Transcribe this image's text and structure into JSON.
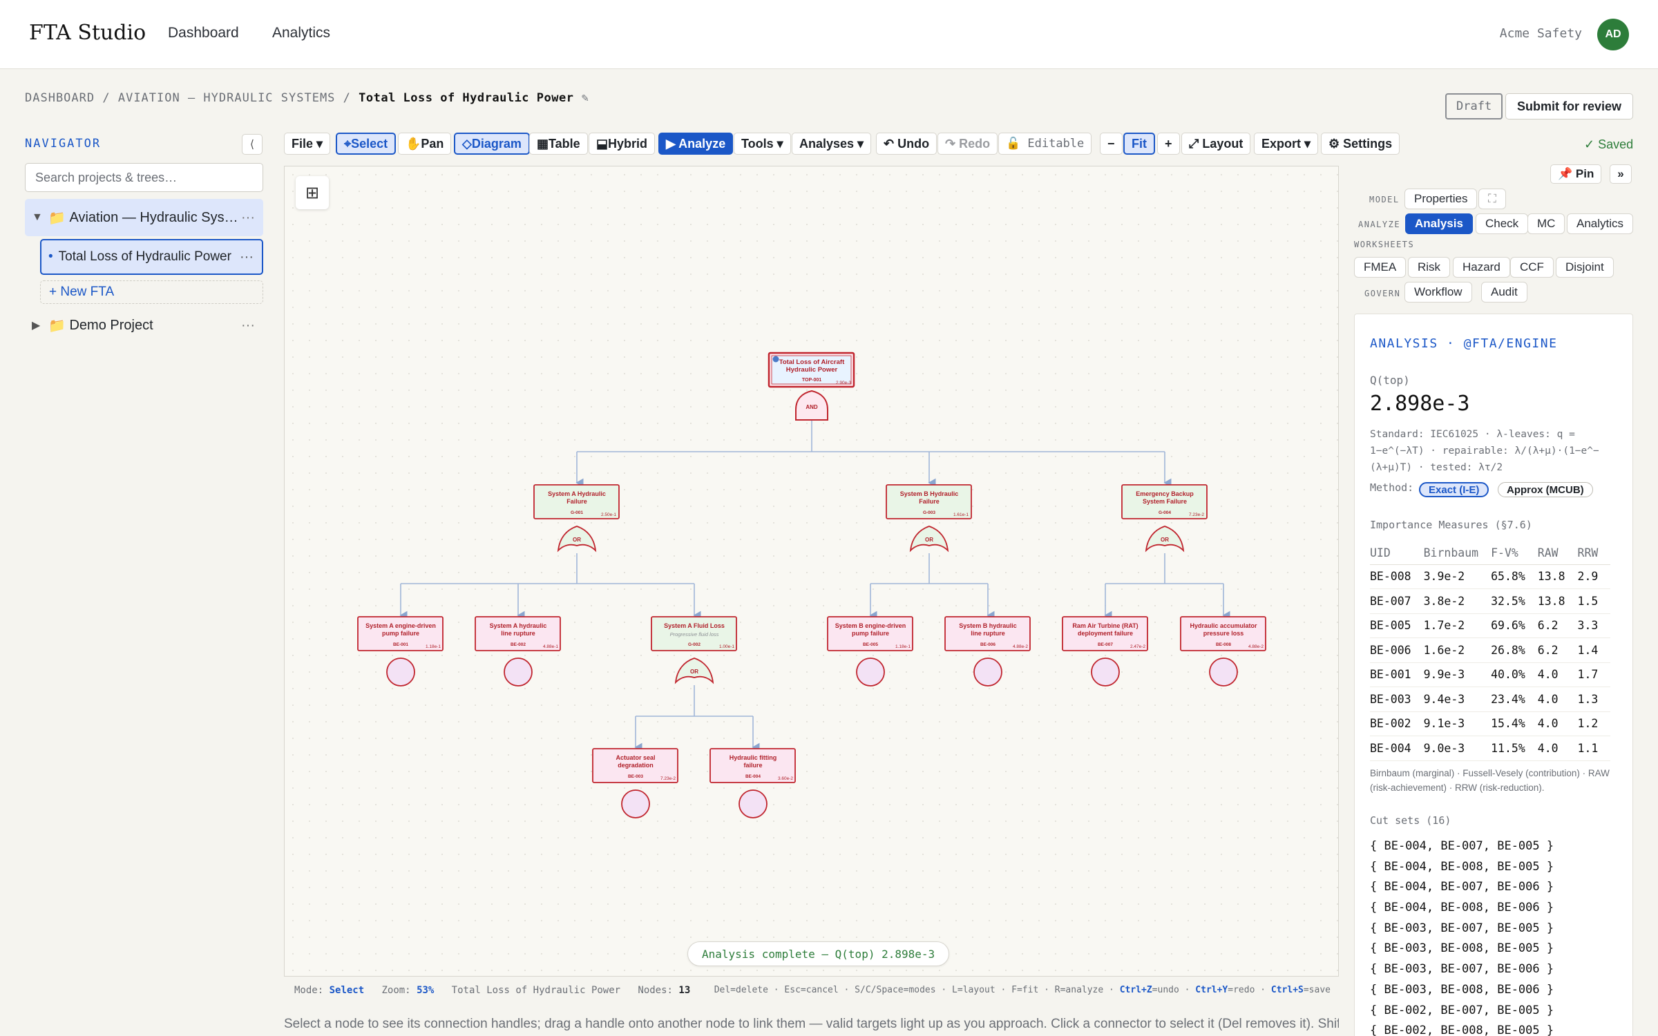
{
  "app": {
    "brand": "FTA Studio",
    "nav": [
      "Dashboard",
      "Analytics"
    ],
    "org": "Acme Safety",
    "avatar": "AD"
  },
  "breadcrumb": {
    "parts": [
      "DASHBOARD",
      "AVIATION — HYDRAULIC SYSTEMS"
    ],
    "current": "Total Loss of Hydraulic Power",
    "edit_icon": "pencil-icon"
  },
  "header_actions": {
    "status": "Draft",
    "submit": "Submit for review"
  },
  "navigator": {
    "title": "NAVIGATOR",
    "collapse": "⟨",
    "search_placeholder": "Search projects & trees…",
    "projects": [
      {
        "name": "Aviation — Hydraulic Sys…",
        "caret": "▼",
        "icon": "📁",
        "more": "···"
      },
      {
        "name": "Demo Project",
        "caret": "▶",
        "icon": "📁",
        "more": "···"
      }
    ],
    "doc": {
      "bullet": "•",
      "name": "Total Loss of Hydraulic Power",
      "more": "···"
    },
    "new": "+ New FTA"
  },
  "toolbar": {
    "file": "File ▾",
    "select": "⌖Select",
    "pan": "✋Pan",
    "diagram": "◇Diagram",
    "table": "▦Table",
    "hybrid": "⬓Hybrid",
    "analyze": "▶ Analyze",
    "tools": "Tools ▾",
    "analyses": "Analyses ▾",
    "undo": "↶ Undo",
    "redo": "↷ Redo",
    "editable": "🔓 Editable",
    "zoom_out": "−",
    "fit": "Fit",
    "zoom_in": "+",
    "layout": "⤢ Layout",
    "export": "Export ▾",
    "settings": "⚙ Settings",
    "saved": "✓ Saved"
  },
  "canvas": {
    "toast": "Analysis complete — Q(top) 2.898e-3",
    "fit_icon": "⊞",
    "nodes": {
      "top": {
        "l1": "Total Loss of Aircraft",
        "l2": "Hydraulic Power",
        "id": "TOP-001",
        "p": "2.90e-3",
        "gate": "AND"
      },
      "g1": {
        "l1": "System A Hydraulic",
        "l2": "Failure",
        "id": "G-001",
        "p": "2.50e-1",
        "gate": "OR"
      },
      "g3": {
        "l1": "System B Hydraulic",
        "l2": "Failure",
        "id": "G-003",
        "p": "1.61e-1",
        "gate": "OR"
      },
      "g4": {
        "l1": "Emergency Backup",
        "l2": "System Failure",
        "id": "G-004",
        "p": "7.23e-2",
        "gate": "OR"
      },
      "be1": {
        "l1": "System A engine-driven",
        "l2": "pump failure",
        "id": "BE-001",
        "p": "1.18e-1"
      },
      "be2": {
        "l1": "System A hydraulic",
        "l2": "line rupture",
        "id": "BE-002",
        "p": "4.88e-1"
      },
      "g2": {
        "l1": "System A Fluid Loss",
        "l2": "Progressive fluid loss",
        "id": "G-002",
        "p": "1.00e-1",
        "gate": "OR"
      },
      "be5": {
        "l1": "System B engine-driven",
        "l2": "pump failure",
        "id": "BE-005",
        "p": "1.18e-1"
      },
      "be6": {
        "l1": "System B hydraulic",
        "l2": "line rupture",
        "id": "BE-006",
        "p": "4.88e-2"
      },
      "be7": {
        "l1": "Ram Air Turbine (RAT)",
        "l2": "deployment failure",
        "id": "BE-007",
        "p": "2.47e-2"
      },
      "be8": {
        "l1": "Hydraulic accumulator",
        "l2": "pressure loss",
        "id": "BE-008",
        "p": "4.88e-2"
      },
      "be3": {
        "l1": "Actuator seal",
        "l2": "degradation",
        "id": "BE-003",
        "p": "7.23e-2"
      },
      "be4": {
        "l1": "Hydraulic fitting",
        "l2": "failure",
        "id": "BE-004",
        "p": "3.60e-2"
      }
    }
  },
  "statusbar": {
    "mode_label": "Mode:",
    "mode": "Select",
    "zoom_label": "Zoom:",
    "zoom": "53%",
    "tree": "Total Loss of Hydraulic Power",
    "nodes_label": "Nodes:",
    "nodes": "13",
    "hints": "Del=delete · Esc=cancel · S/C/Space=modes · L=layout · F=fit · R=analyze ·",
    "k1": "Ctrl+Z",
    "k1t": "=undo ·",
    "k2": "Ctrl+Y",
    "k2t": "=redo ·",
    "k3": "Ctrl+S",
    "k3t": "=save"
  },
  "help_text": "Select a node to see its connection handles; drag a handle onto another node to link them — valid targets light up as you approach. Click a connector to select it (Del removes it). Shift-drag",
  "panel": {
    "pin": "📌 Pin",
    "expand": "»",
    "groups": {
      "model": "MODEL",
      "analyze": "ANALYZE",
      "worksheets": "WORKSHEETS",
      "govern": "GOVERN"
    },
    "model_tabs": [
      "Properties",
      "⛶"
    ],
    "analyze_tabs": [
      "Analysis",
      "Check",
      "MC",
      "Analytics"
    ],
    "worksheet_tabs": [
      "FMEA",
      "Risk",
      "Hazard",
      "CCF",
      "Disjoint"
    ],
    "govern_tabs": [
      "Workflow",
      "Audit"
    ],
    "analysis": {
      "title": "ANALYSIS · @FTA/ENGINE",
      "q_label": "Q(top)",
      "q_value": "2.898e-3",
      "standard": "Standard: IEC61025 · λ-leaves: q = 1−e^(−λT) · repairable: λ/(λ+μ)·(1−e^−(λ+μ)T) · tested: λτ/2",
      "method_label": "Method:",
      "methods": [
        "Exact (I-E)",
        "Approx (MCUB)"
      ],
      "importance_title": "Importance Measures (§7.6)",
      "columns": [
        "UID",
        "Birnbaum",
        "F-V%",
        "RAW",
        "RRW"
      ],
      "rows": [
        [
          "BE-008",
          "3.9e-2",
          "65.8%",
          "13.8",
          "2.9"
        ],
        [
          "BE-007",
          "3.8e-2",
          "32.5%",
          "13.8",
          "1.5"
        ],
        [
          "BE-005",
          "1.7e-2",
          "69.6%",
          "6.2",
          "3.3"
        ],
        [
          "BE-006",
          "1.6e-2",
          "26.8%",
          "6.2",
          "1.4"
        ],
        [
          "BE-001",
          "9.9e-3",
          "40.0%",
          "4.0",
          "1.7"
        ],
        [
          "BE-003",
          "9.4e-3",
          "23.4%",
          "4.0",
          "1.3"
        ],
        [
          "BE-002",
          "9.1e-3",
          "15.4%",
          "4.0",
          "1.2"
        ],
        [
          "BE-004",
          "9.0e-3",
          "11.5%",
          "4.0",
          "1.1"
        ]
      ],
      "legend": "Birnbaum (marginal) · Fussell-Vesely (contribution) · RAW (risk-achievement) · RRW (risk-reduction).",
      "cutsets_title": "Cut sets (16)",
      "cutsets": [
        "{ BE-004, BE-007, BE-005 }",
        "{ BE-004, BE-008, BE-005 }",
        "{ BE-004, BE-007, BE-006 }",
        "{ BE-004, BE-008, BE-006 }",
        "{ BE-003, BE-007, BE-005 }",
        "{ BE-003, BE-008, BE-005 }",
        "{ BE-003, BE-007, BE-006 }",
        "{ BE-003, BE-008, BE-006 }",
        "{ BE-002, BE-007, BE-005 }",
        "{ BE-002, BE-008, BE-005 }"
      ]
    }
  },
  "colors": {
    "accent": "#1b57c7",
    "ok": "#2d7d3a",
    "gate_border": "#c0242d",
    "raw": "#c77a0a"
  }
}
